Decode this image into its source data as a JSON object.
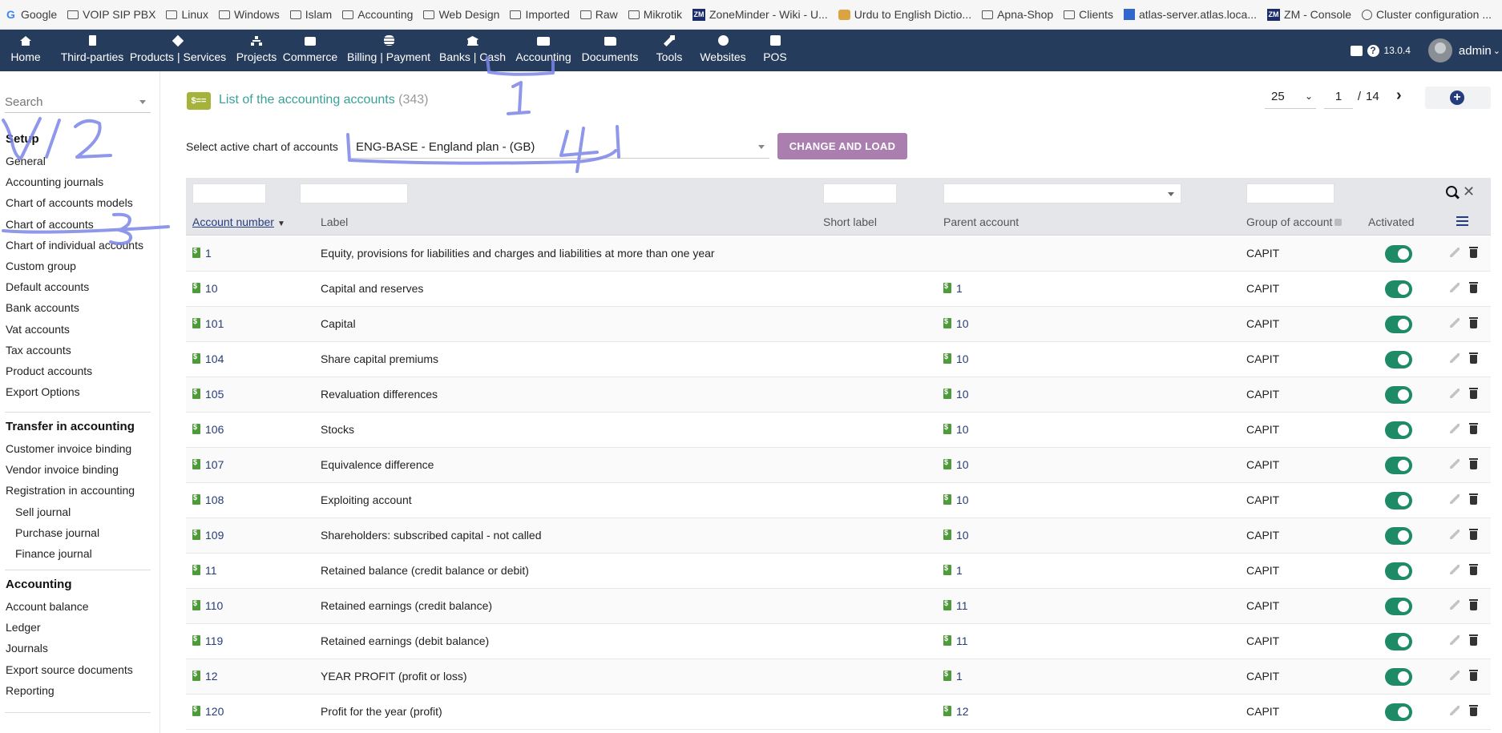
{
  "bookmarks": [
    {
      "icon": "google-icon",
      "label": "Google"
    },
    {
      "icon": "folder-icon",
      "label": "VOIP SIP PBX"
    },
    {
      "icon": "folder-icon",
      "label": "Linux"
    },
    {
      "icon": "folder-icon",
      "label": "Windows"
    },
    {
      "icon": "folder-icon",
      "label": "Islam"
    },
    {
      "icon": "folder-icon",
      "label": "Accounting"
    },
    {
      "icon": "folder-icon",
      "label": "Web Design"
    },
    {
      "icon": "folder-icon",
      "label": "Imported"
    },
    {
      "icon": "folder-icon",
      "label": "Raw"
    },
    {
      "icon": "folder-icon",
      "label": "Mikrotik"
    },
    {
      "icon": "zm-icon",
      "label": "ZoneMinder - Wiki - U..."
    },
    {
      "icon": "dictionary-icon",
      "label": "Urdu to English Dictio..."
    },
    {
      "icon": "folder-icon",
      "label": "Apna-Shop"
    },
    {
      "icon": "folder-icon",
      "label": "Clients"
    },
    {
      "icon": "atlas-icon",
      "label": "atlas-server.atlas.loca..."
    },
    {
      "icon": "zm-icon",
      "label": "ZM - Console"
    },
    {
      "icon": "globe-icon",
      "label": "Cluster configuration ..."
    }
  ],
  "topnav": {
    "items": [
      {
        "icon": "home-icon",
        "label": "Home"
      },
      {
        "icon": "building-icon",
        "label": "Third-parties"
      },
      {
        "icon": "cube-icon",
        "label": "Products | Services"
      },
      {
        "icon": "sitemap-icon",
        "label": "Projects"
      },
      {
        "icon": "briefcase-icon",
        "label": "Commerce"
      },
      {
        "icon": "coins-icon",
        "label": "Billing | Payment"
      },
      {
        "icon": "bank-icon",
        "label": "Banks | Cash"
      },
      {
        "icon": "money-icon",
        "label": "Accounting"
      },
      {
        "icon": "folder-open-icon",
        "label": "Documents"
      },
      {
        "icon": "wrench-icon",
        "label": "Tools"
      },
      {
        "icon": "globe-icon",
        "label": "Websites"
      },
      {
        "icon": "cash-register-icon",
        "label": "POS"
      }
    ],
    "version": "13.0.4",
    "user": "admin"
  },
  "sidebar": {
    "search_placeholder": "Search",
    "setup_title": "Setup",
    "setup_items": [
      "General",
      "Accounting journals",
      "Chart of accounts models",
      "Chart of accounts",
      "Chart of individual accounts",
      "Custom group",
      "Default accounts",
      "Bank accounts",
      "Vat accounts",
      "Tax accounts",
      "Product accounts",
      "Export Options"
    ],
    "transfer_title": "Transfer in accounting",
    "transfer_items": [
      "Customer invoice binding",
      "Vendor invoice binding",
      "Registration in accounting"
    ],
    "transfer_subitems": [
      "Sell journal",
      "Purchase journal",
      "Finance journal"
    ],
    "accounting_title": "Accounting",
    "accounting_items": [
      "Account balance",
      "Ledger",
      "Journals",
      "Export source documents",
      "Reporting"
    ]
  },
  "page": {
    "title": "List of the accounting accounts",
    "count": "(343)",
    "per_page": "25",
    "current_page": "1",
    "page_sep": "/",
    "total_pages": "14",
    "chart_label": "Select active chart of accounts",
    "chart_value": "ENG-BASE - England plan - (GB)",
    "change_button": "CHANGE AND LOAD"
  },
  "table": {
    "headers": {
      "account": "Account number",
      "label": "Label",
      "short_label": "Short label",
      "parent": "Parent account",
      "group": "Group of account",
      "activated": "Activated"
    },
    "rows": [
      {
        "account": "1",
        "label": "Equity, provisions for liabilities and charges and liabilities at more than one year",
        "short": "",
        "parent": "",
        "group": "CAPIT",
        "active": true
      },
      {
        "account": "10",
        "label": "Capital and reserves",
        "short": "",
        "parent": "1",
        "group": "CAPIT",
        "active": true
      },
      {
        "account": "101",
        "label": "Capital",
        "short": "",
        "parent": "10",
        "group": "CAPIT",
        "active": true
      },
      {
        "account": "104",
        "label": "Share capital premiums",
        "short": "",
        "parent": "10",
        "group": "CAPIT",
        "active": true
      },
      {
        "account": "105",
        "label": "Revaluation differences",
        "short": "",
        "parent": "10",
        "group": "CAPIT",
        "active": true
      },
      {
        "account": "106",
        "label": "Stocks",
        "short": "",
        "parent": "10",
        "group": "CAPIT",
        "active": true
      },
      {
        "account": "107",
        "label": "Equivalence difference",
        "short": "",
        "parent": "10",
        "group": "CAPIT",
        "active": true
      },
      {
        "account": "108",
        "label": "Exploiting account",
        "short": "",
        "parent": "10",
        "group": "CAPIT",
        "active": true
      },
      {
        "account": "109",
        "label": "Shareholders: subscribed capital - not called",
        "short": "",
        "parent": "10",
        "group": "CAPIT",
        "active": true
      },
      {
        "account": "11",
        "label": "Retained balance (credit balance or debit)",
        "short": "",
        "parent": "1",
        "group": "CAPIT",
        "active": true
      },
      {
        "account": "110",
        "label": "Retained earnings (credit balance)",
        "short": "",
        "parent": "11",
        "group": "CAPIT",
        "active": true
      },
      {
        "account": "119",
        "label": "Retained earnings (debit balance)",
        "short": "",
        "parent": "11",
        "group": "CAPIT",
        "active": true
      },
      {
        "account": "12",
        "label": "YEAR PROFIT (profit or loss)",
        "short": "",
        "parent": "1",
        "group": "CAPIT",
        "active": true
      },
      {
        "account": "120",
        "label": "Profit for the year (profit)",
        "short": "",
        "parent": "12",
        "group": "CAPIT",
        "active": true
      }
    ]
  },
  "annotations": [
    "1",
    "/2",
    "3",
    "4"
  ],
  "colors": {
    "nav_bg": "#263c5c",
    "title_teal": "#3aa19b",
    "button_purple": "#aa7fb0",
    "toggle_green": "#1e8a66",
    "link_navy": "#263c7c",
    "annotation_blue": "#7b86e6"
  }
}
